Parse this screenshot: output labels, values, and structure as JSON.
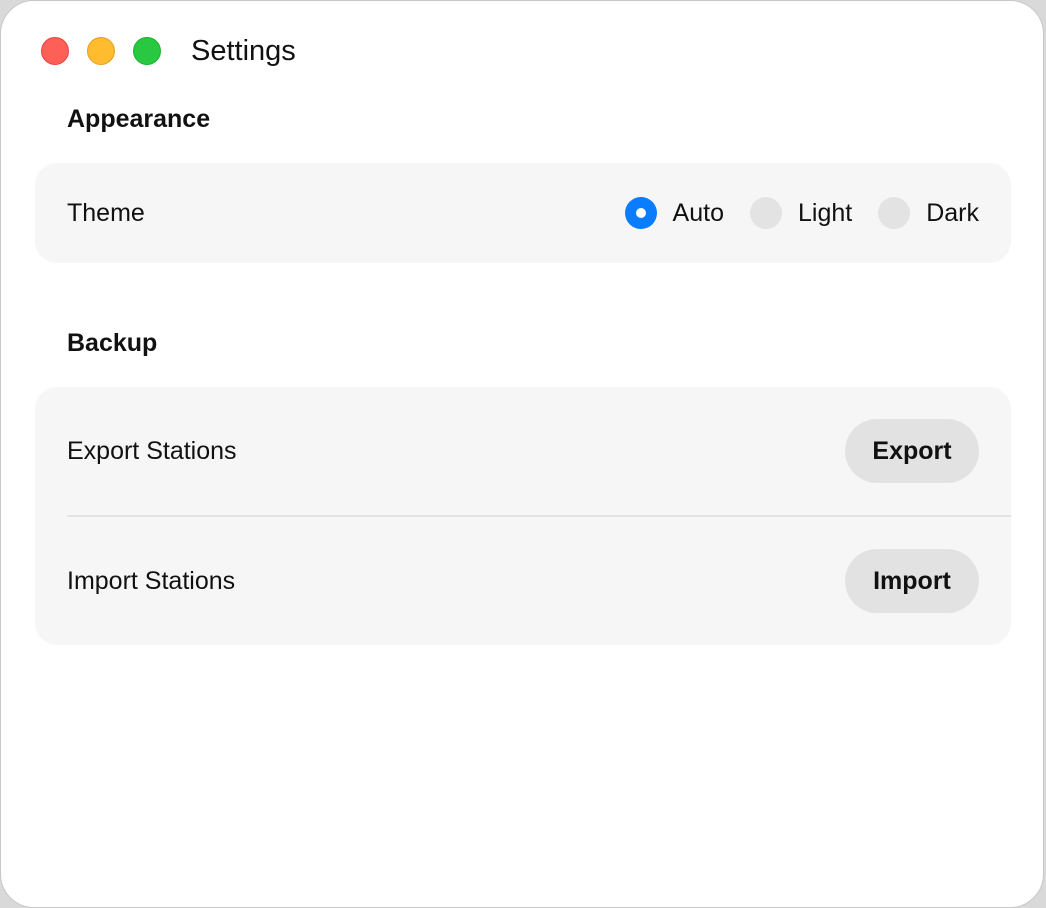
{
  "window": {
    "title": "Settings"
  },
  "appearance": {
    "section_title": "Appearance",
    "theme": {
      "label": "Theme",
      "options": [
        {
          "label": "Auto",
          "checked": true
        },
        {
          "label": "Light",
          "checked": false
        },
        {
          "label": "Dark",
          "checked": false
        }
      ]
    }
  },
  "backup": {
    "section_title": "Backup",
    "export": {
      "label": "Export Stations",
      "button": "Export"
    },
    "import": {
      "label": "Import Stations",
      "button": "Import"
    }
  },
  "colors": {
    "accent": "#0a7cff",
    "card_background": "#f6f6f6",
    "button_background": "#e2e2e2",
    "close": "#fe5f57",
    "minimize": "#febc2e",
    "zoom": "#28c840"
  }
}
